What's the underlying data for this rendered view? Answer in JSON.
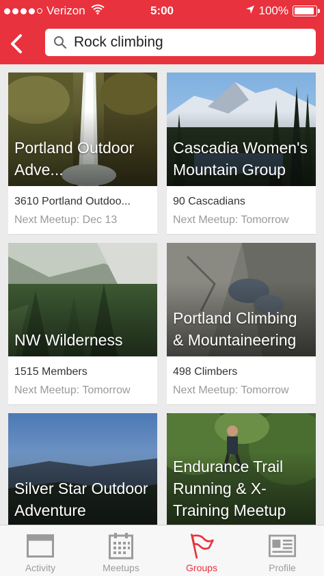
{
  "status_bar": {
    "carrier": "Verizon",
    "time": "5:00",
    "battery": "100%",
    "battery_level": 1.0
  },
  "header": {
    "search_value": "Rock climbing"
  },
  "groups": [
    {
      "title": "Portland Outdoor Adve...",
      "members": "3610 Portland Outdoo...",
      "next": "Next Meetup: Dec 13"
    },
    {
      "title": "Cascadia Women's Mountain Group",
      "members": "90 Cascadians",
      "next": "Next Meetup: Tomorrow"
    },
    {
      "title": "NW Wilderness",
      "members": "1515 Members",
      "next": "Next Meetup: Tomorrow"
    },
    {
      "title": "Portland Climbing & Mountaineering",
      "members": "498 Climbers",
      "next": "Next Meetup: Tomorrow"
    },
    {
      "title": "Silver Star Outdoor Adventure",
      "members": "",
      "next": ""
    },
    {
      "title": "Endurance Trail Running & X-Training Meetup",
      "members": "",
      "next": ""
    }
  ],
  "tabs": [
    {
      "label": "Activity",
      "icon": "activity-icon"
    },
    {
      "label": "Meetups",
      "icon": "calendar-icon"
    },
    {
      "label": "Groups",
      "icon": "flag-icon"
    },
    {
      "label": "Profile",
      "icon": "profile-card-icon"
    }
  ],
  "colors": {
    "brand": "#e8323d",
    "tab_inactive": "#9b9b9b"
  }
}
